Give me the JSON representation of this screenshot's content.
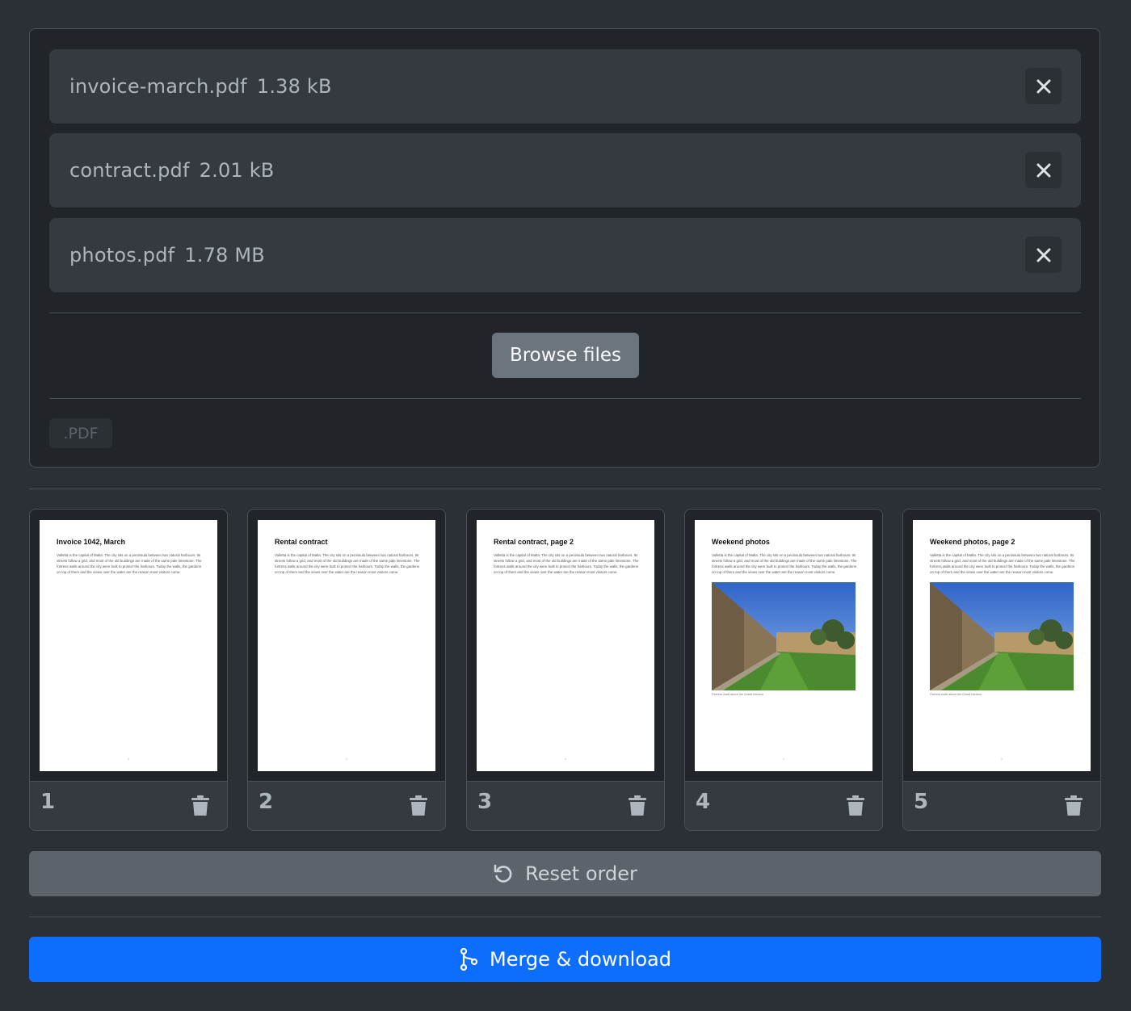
{
  "files": [
    {
      "name": "invoice-march.pdf",
      "size": "1.38 kB"
    },
    {
      "name": "contract.pdf",
      "size": "2.01 kB"
    },
    {
      "name": "photos.pdf",
      "size": "1.78 MB"
    }
  ],
  "upload": {
    "browse_label": "Browse files",
    "accepted_ext": ".PDF"
  },
  "pages": [
    {
      "number": "1",
      "title": "Invoice 1042, March",
      "text": "Valletta is the capital of Malta. The city sits on a peninsula between two natural harbours. Its streets follow a grid, and most of the old buildings are made of the same pale limestone. The fortress walls around the city were built to protect the harbours. Today the walls, the gardens on top of them and the views over the water are the reason most visitors come.",
      "caption": "",
      "page_label": "1"
    },
    {
      "number": "2",
      "title": "Rental contract",
      "text": "Valletta is the capital of Malta. The city sits on a peninsula between two natural harbours. Its streets follow a grid, and most of the old buildings are made of the same pale limestone. The fortress walls around the city were built to protect the harbours. Today the walls, the gardens on top of them and the views over the water are the reason most visitors come.",
      "caption": "",
      "page_label": "1"
    },
    {
      "number": "3",
      "title": "Rental contract, page 2",
      "text": "Valletta is the capital of Malta. The city sits on a peninsula between two natural harbours. Its streets follow a grid, and most of the old buildings are made of the same pale limestone. The fortress walls around the city were built to protect the harbours. Today the walls, the gardens on top of them and the views over the water are the reason most visitors come.",
      "caption": "",
      "page_label": "1"
    },
    {
      "number": "4",
      "title": "Weekend photos",
      "text": "Valletta is the capital of Malta. The city sits on a peninsula between two natural harbours. Its streets follow a grid, and most of the old buildings are made of the same pale limestone. The fortress walls around the city were built to protect the harbours. Today the walls, the gardens on top of them and the views over the water are the reason most visitors come.",
      "caption": "Fortress walls above the Grand Harbour.",
      "page_label": "1"
    },
    {
      "number": "5",
      "title": "Weekend photos, page 2",
      "text": "Valletta is the capital of Malta. The city sits on a peninsula between two natural harbours. Its streets follow a grid, and most of the old buildings are made of the same pale limestone. The fortress walls around the city were built to protect the harbours. Today the walls, the gardens on top of them and the views over the water are the reason most visitors come.",
      "caption": "Fortress walls above the Grand Harbour.",
      "page_label": "1"
    }
  ],
  "actions": {
    "reset_label": "Reset order",
    "merge_label": "Merge & download"
  },
  "icons": {
    "remove": "close-icon",
    "delete": "trash-icon",
    "reset": "rotate-ccw-icon",
    "merge": "git-merge-icon"
  },
  "colors": {
    "primary": "#0d6efd",
    "secondary": "#6c757d",
    "background": "#2b3036"
  }
}
